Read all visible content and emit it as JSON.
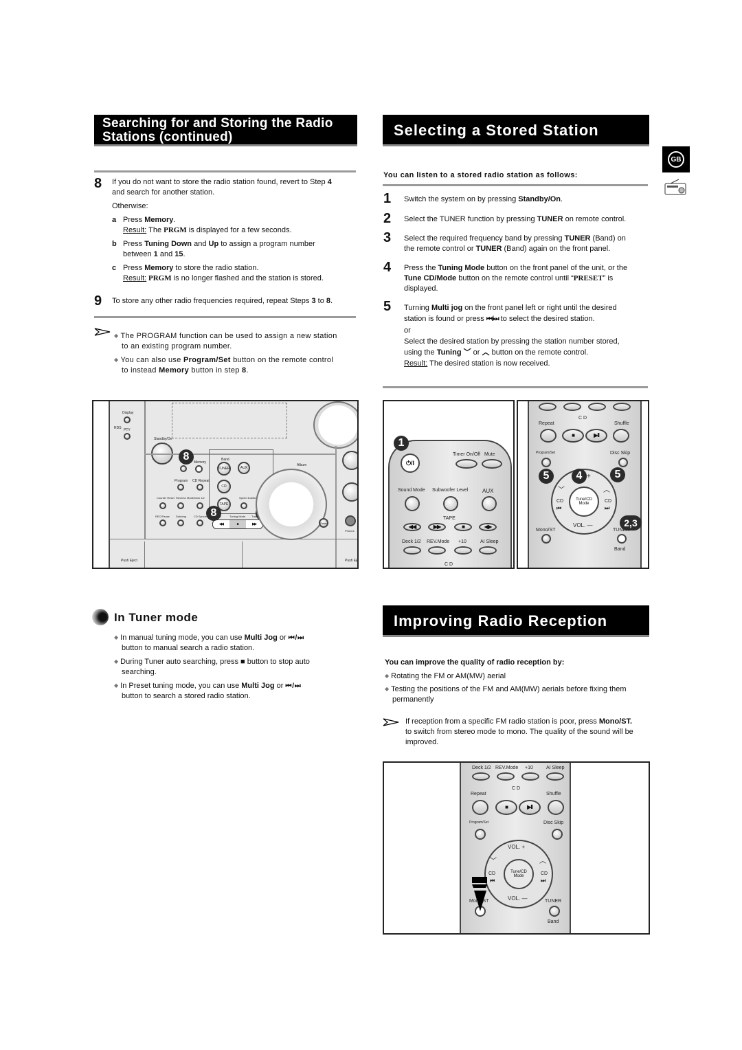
{
  "left_section": {
    "title_line1": "Searching for and Storing the Radio",
    "title_line2": "Stations (continued)",
    "step8": {
      "num": "8",
      "text_a": "If you do not want to store the radio station found, revert to Step ",
      "text_b": "4",
      "text_c": "and search for another station.",
      "otherwise": "Otherwise:",
      "sub_a": {
        "letter": "a",
        "pre": "Press ",
        "bold": "Memory",
        "post": ".",
        "result_label": "Result:",
        "result_pre": " The ",
        "result_serif": "PRGM",
        "result_post": " is displayed for a few seconds."
      },
      "sub_b": {
        "letter": "b",
        "pre": "Press ",
        "bold1": "Tuning Down",
        "mid": " and ",
        "bold2": "Up",
        "post": " to assign a program number",
        "line2_pre": "between ",
        "line2_b1": "1",
        "line2_mid": " and ",
        "line2_b2": "15",
        "line2_post": "."
      },
      "sub_c": {
        "letter": "c",
        "pre": "Press ",
        "bold": "Memory",
        "post": " to store the radio station.",
        "result_label": "Result:",
        "result_serif": " PRGM",
        "result_post": " is no longer flashed and the station is stored."
      }
    },
    "step9": {
      "num": "9",
      "pre": "To store any other radio frequencies required, repeat Steps ",
      "b1": "3",
      "mid": " to ",
      "b2": "8",
      "post": "."
    },
    "notes": [
      {
        "line1": "The PROGRAM function can be used to assign a new station",
        "line2": "to an existing program number."
      },
      {
        "pre": "You can also use ",
        "bold1": "Program/Set",
        "mid": " button on the remote control",
        "line2_pre": "to instead ",
        "bold2": "Memory",
        "line2_mid": " button in step ",
        "bold3": "8",
        "line2_post": "."
      }
    ],
    "panel_figure": {
      "callouts": [
        "8",
        "8",
        "8"
      ],
      "labels": [
        "Display",
        "RDS",
        "PTY",
        "Standby/On",
        "Memory",
        "Band",
        "TUNER",
        "AUX",
        "Program",
        "CD Repeat",
        "CD",
        "Counter Reset",
        "Reverse Mode",
        "Deck 1/2",
        "TAPE",
        "Speed Dubbing",
        "REC/Pause",
        "Dubbing",
        "CD Synchro",
        "Track",
        "Tuning Mode",
        "Track",
        "Album",
        "Enter",
        "Push Eject",
        "Push Eject",
        "Phones"
      ]
    }
  },
  "tuner_mode": {
    "title": "In Tuner mode",
    "bullets": [
      {
        "pre": "In manual tuning mode, you can use ",
        "bold": "Multi Jog",
        "mid": " or ",
        "glyph": "⏮ / ⏭",
        "line2": "button to manual search a radio station."
      },
      {
        "pre": "During Tuner auto searching, press ",
        "glyph": "■",
        "mid": " button to stop auto",
        "line2": "searching."
      },
      {
        "pre": "In Preset tuning mode, you can use ",
        "bold": "Multi Jog",
        "mid": " or ",
        "glyph": "⏮ / ⏭",
        "line2": "button to search a stored radio station."
      }
    ]
  },
  "right_section": {
    "title": "Selecting a Stored Station",
    "intro": "You can listen to a stored radio station as follows:",
    "steps": [
      {
        "num": "1",
        "pre": "Switch the system on by pressing ",
        "bold": "Standby/On",
        "post": "."
      },
      {
        "num": "2",
        "pre": "Select the TUNER function by pressing ",
        "bold": "TUNER",
        "post": " on remote control."
      },
      {
        "num": "3",
        "pre": "Select the required frequency band by pressing ",
        "bold": "TUNER",
        "post": " (Band) on",
        "line2_pre": "the remote control or ",
        "line2_bold": "TUNER",
        "line2_post": " (Band) again on the front panel."
      },
      {
        "num": "4",
        "pre": "Press the ",
        "bold": "Tuning Mode",
        "post": " button on the front panel of the unit, or the",
        "line2_bold": "Tune CD/Mode",
        "line2_post": " button on the remote control until “",
        "line2_serif": "PRESET",
        "line2_end": "” is",
        "line3": "displayed."
      },
      {
        "num": "5",
        "pre": "Turning ",
        "bold": "Multi jog",
        "post": " on the front panel left or right until the desired",
        "line2_pre": "station is found or press ",
        "line2_glyph": "⏮/⏭",
        "line2_post": " to select the desired station.",
        "line3": "or",
        "line4": "Select the desired station by pressing the station number stored,",
        "line5_pre": "using the ",
        "line5_bold": "Tuning",
        "line5_glyph1": "﹀",
        "line5_mid": " or ",
        "line5_glyph2": "︿",
        "line5_post": " button on the remote control.",
        "result_label": "Result:",
        "result_text": " The desired station is now received."
      }
    ],
    "remote_figure_a": {
      "callout": "1",
      "power_glyph": "⏻/I",
      "labels": {
        "timer": "Timer On/Off",
        "mute": "Mute",
        "sound_mode": "Sound Mode",
        "subwoofer": "Subwoofer Level",
        "aux": "AUX",
        "tape": "TAPE",
        "deck": "Deck 1/2",
        "rev": "REV.Mode",
        "plus10": "+10",
        "sleep": "AI Sleep",
        "cd": "C D"
      },
      "tape_glyphs": [
        "◀◀",
        "▶▶",
        "■",
        "◀▶"
      ]
    },
    "remote_figure_b": {
      "callouts": [
        "5",
        "4",
        "5",
        "2,3"
      ],
      "labels": {
        "cd": "C D",
        "repeat": "Repeat",
        "shuffle": "Shuffle",
        "program_set": "Program/Set",
        "disc_skip": "Disc Skip",
        "plus": "+",
        "tune_cd": "Tune/CD",
        "mode": "Mode",
        "cd_left": "CD",
        "cd_right": "CD",
        "vol_minus": "VOL. —",
        "mono": "Mono/ST",
        "tuner": "TUNER",
        "band": "Band"
      },
      "glyphs": {
        "stop": "■",
        "play_pause": "▶II",
        "prev": "⏮",
        "next": "⏭",
        "down": "﹀",
        "up": "︿"
      }
    }
  },
  "improving": {
    "title": "Improving Radio Reception",
    "intro": "You can improve the quality of radio reception by:",
    "bullets": [
      {
        "text": "Rotating the FM or AM(MW) aerial"
      },
      {
        "line1": "Testing the positions of the FM and AM(MW) aerials before fixing them",
        "line2": "permanently"
      }
    ],
    "note": {
      "pre": "If reception from a specific FM radio station is poor, press ",
      "bold": "Mono/ST.",
      "line2": "to switch from stereo mode to mono. The quality of the sound will be",
      "line3": "improved."
    },
    "remote_figure": {
      "labels": {
        "deck": "Deck 1/2",
        "rev": "REV.Mode",
        "plus10": "+10",
        "sleep": "AI Sleep",
        "cd": "C D",
        "repeat": "Repeat",
        "shuffle": "Shuffle",
        "program_set": "Program/Set",
        "disc_skip": "Disc Skip",
        "vol_plus": "VOL. +",
        "tune_cd": "Tune/CD",
        "mode": "Mode",
        "cd_left": "CD",
        "cd_right": "CD",
        "vol_minus": "VOL. —",
        "mono": "Mono/ST",
        "tuner": "TUNER",
        "band": "Band"
      },
      "glyphs": {
        "stop": "■",
        "play_pause": "▶II",
        "prev": "⏮",
        "next": "⏭",
        "down": "﹀",
        "up": "︿"
      }
    }
  },
  "side_tab": {
    "language": "GB",
    "icon": "radio-icon"
  }
}
